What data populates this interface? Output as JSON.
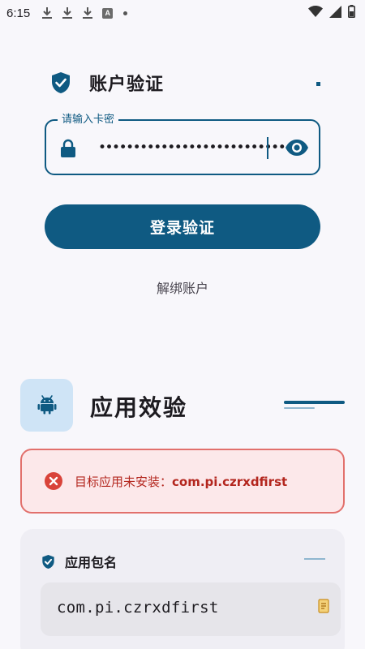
{
  "status_bar": {
    "time": "6:15",
    "left_icons": [
      "download-icon",
      "download-icon",
      "download-icon",
      "a-badge-icon",
      "dot-icon"
    ],
    "a_badge": "A",
    "right_icons": [
      "wifi-icon",
      "signal-icon",
      "battery-icon"
    ]
  },
  "account": {
    "title": "账户验证",
    "card_key_label": "请输入卡密",
    "card_key_value": "••••••••••••••••••••••••••••",
    "login_button": "登录验证",
    "unbind_link": "解绑账户"
  },
  "app_verify": {
    "title": "应用效验",
    "error_prefix": "目标应用未安装：",
    "error_package": "com.pi.czrxdfirst",
    "package_label": "应用包名",
    "package_value": "com.pi.czrxdfirst"
  },
  "colors": {
    "primary": "#0f5a82",
    "error": "#b3261e",
    "error_bg": "#fce8ea",
    "icon_box_bg": "#cfe4f6"
  }
}
